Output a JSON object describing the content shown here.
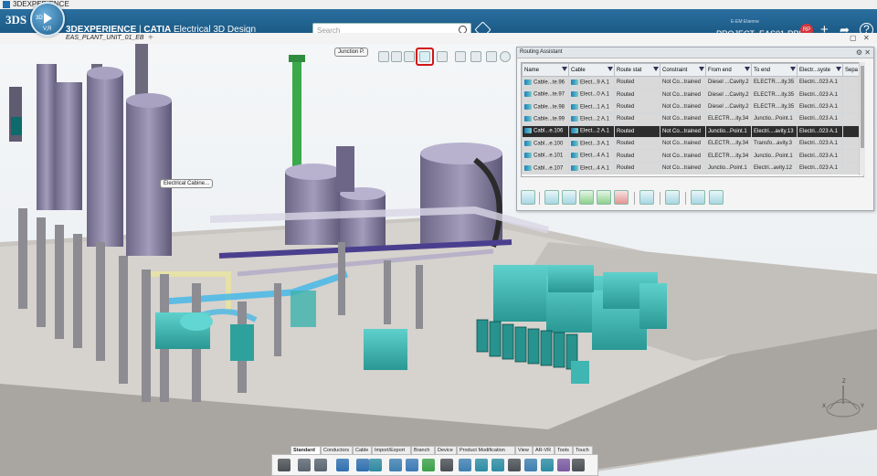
{
  "window": {
    "title": "3DEXPERIENCE"
  },
  "header": {
    "brand": "3DEXPERIENCE",
    "app_name": "CATIA",
    "app_module": "Electrical 3D Design",
    "compass_labels": [
      "3D",
      "V,R"
    ],
    "search_placeholder": "Search",
    "user_small": "E-EM Etienne",
    "project": "PROJECT_EAS01-RPE",
    "avatar": "RP",
    "icons": [
      "tag-icon",
      "add-icon",
      "share-icon",
      "help-icon"
    ]
  },
  "doc_tab": {
    "label": "EAS_PLANT_UNIT_01_EB",
    "plus": "+"
  },
  "viewport": {
    "tooltips": [
      "Junction P.",
      "Electrical Cabine..."
    ]
  },
  "routing_assistant": {
    "title": "Routing Assistant",
    "columns": [
      "Name",
      "Cable",
      "Route stat",
      "Constraint",
      "From end",
      "To end",
      "Electr...syste",
      "Sepa"
    ],
    "rows": [
      [
        "Cable...te.96",
        "Elect...9 A.1",
        "Routed",
        "Not Co...trained",
        "Diesel ...Cavity.2",
        "ELECTR....ity.35",
        "Electri...023 A.1",
        ""
      ],
      [
        "Cable...te.97",
        "Elect...0 A.1",
        "Routed",
        "Not Co...trained",
        "Diesel ...Cavity.2",
        "ELECTR....ity.35",
        "Electri...023 A.1",
        ""
      ],
      [
        "Cable...te.98",
        "Elect...1 A.1",
        "Routed",
        "Not Co...trained",
        "Diesel ...Cavity.2",
        "ELECTR....ity.35",
        "Electri...023 A.1",
        ""
      ],
      [
        "Cable...te.99",
        "Elect...2 A.1",
        "Routed",
        "Not Co...trained",
        "ELECTR....ity.34",
        "Junctio...Point.1",
        "Electri...023 A.1",
        ""
      ],
      [
        "Cabl...e.106",
        "Elect...2 A.1",
        "Routed",
        "Not Co...trained",
        "Junctio...Point.1",
        "Electri....avity.13",
        "Electri...023 A.1",
        ""
      ],
      [
        "Cabl...e.100",
        "Elect...3 A.1",
        "Routed",
        "Not Co...trained",
        "ELECTR....ity.34",
        "Transfo...avity.3",
        "Electri...023 A.1",
        ""
      ],
      [
        "Cabl...e.101",
        "Elect...4 A.1",
        "Routed",
        "Not Co...trained",
        "ELECTR....ity.34",
        "Junctio...Point.1",
        "Electri...023 A.1",
        ""
      ],
      [
        "Cabl...e.107",
        "Elect...4 A.1",
        "Routed",
        "Not Co...trained",
        "Junctio...Point.1",
        "Electri...avity.12",
        "Electri...023 A.1",
        ""
      ]
    ],
    "selected_row": 4
  },
  "bottom_tabs": [
    "Standard",
    "Conductors",
    "Cable",
    "Import/Export",
    "Branch",
    "Device",
    "Product Modification",
    "View",
    "AR-VR",
    "Tools",
    "Touch"
  ],
  "active_bottom_tab": "Standard",
  "compass_axes": [
    "Z",
    "X",
    "Y"
  ],
  "colors": {
    "brand_blue": "#1c5a86",
    "highlight_red": "#d01616",
    "equipment_cyan": "#3fb6b2",
    "tank_purple": "#8f88a8"
  }
}
